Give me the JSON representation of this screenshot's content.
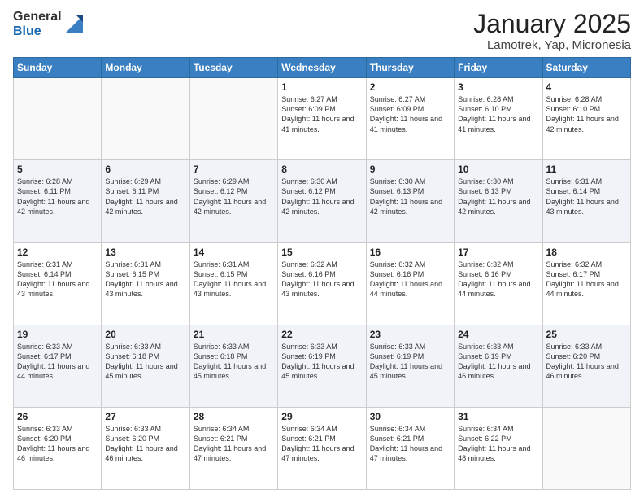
{
  "logo": {
    "line1": "General",
    "line2": "Blue"
  },
  "header": {
    "title": "January 2025",
    "subtitle": "Lamotrek, Yap, Micronesia"
  },
  "days_of_week": [
    "Sunday",
    "Monday",
    "Tuesday",
    "Wednesday",
    "Thursday",
    "Friday",
    "Saturday"
  ],
  "weeks": [
    [
      {
        "day": "",
        "info": ""
      },
      {
        "day": "",
        "info": ""
      },
      {
        "day": "",
        "info": ""
      },
      {
        "day": "1",
        "info": "Sunrise: 6:27 AM\nSunset: 6:09 PM\nDaylight: 11 hours and 41 minutes."
      },
      {
        "day": "2",
        "info": "Sunrise: 6:27 AM\nSunset: 6:09 PM\nDaylight: 11 hours and 41 minutes."
      },
      {
        "day": "3",
        "info": "Sunrise: 6:28 AM\nSunset: 6:10 PM\nDaylight: 11 hours and 41 minutes."
      },
      {
        "day": "4",
        "info": "Sunrise: 6:28 AM\nSunset: 6:10 PM\nDaylight: 11 hours and 42 minutes."
      }
    ],
    [
      {
        "day": "5",
        "info": "Sunrise: 6:28 AM\nSunset: 6:11 PM\nDaylight: 11 hours and 42 minutes."
      },
      {
        "day": "6",
        "info": "Sunrise: 6:29 AM\nSunset: 6:11 PM\nDaylight: 11 hours and 42 minutes."
      },
      {
        "day": "7",
        "info": "Sunrise: 6:29 AM\nSunset: 6:12 PM\nDaylight: 11 hours and 42 minutes."
      },
      {
        "day": "8",
        "info": "Sunrise: 6:30 AM\nSunset: 6:12 PM\nDaylight: 11 hours and 42 minutes."
      },
      {
        "day": "9",
        "info": "Sunrise: 6:30 AM\nSunset: 6:13 PM\nDaylight: 11 hours and 42 minutes."
      },
      {
        "day": "10",
        "info": "Sunrise: 6:30 AM\nSunset: 6:13 PM\nDaylight: 11 hours and 42 minutes."
      },
      {
        "day": "11",
        "info": "Sunrise: 6:31 AM\nSunset: 6:14 PM\nDaylight: 11 hours and 43 minutes."
      }
    ],
    [
      {
        "day": "12",
        "info": "Sunrise: 6:31 AM\nSunset: 6:14 PM\nDaylight: 11 hours and 43 minutes."
      },
      {
        "day": "13",
        "info": "Sunrise: 6:31 AM\nSunset: 6:15 PM\nDaylight: 11 hours and 43 minutes."
      },
      {
        "day": "14",
        "info": "Sunrise: 6:31 AM\nSunset: 6:15 PM\nDaylight: 11 hours and 43 minutes."
      },
      {
        "day": "15",
        "info": "Sunrise: 6:32 AM\nSunset: 6:16 PM\nDaylight: 11 hours and 43 minutes."
      },
      {
        "day": "16",
        "info": "Sunrise: 6:32 AM\nSunset: 6:16 PM\nDaylight: 11 hours and 44 minutes."
      },
      {
        "day": "17",
        "info": "Sunrise: 6:32 AM\nSunset: 6:16 PM\nDaylight: 11 hours and 44 minutes."
      },
      {
        "day": "18",
        "info": "Sunrise: 6:32 AM\nSunset: 6:17 PM\nDaylight: 11 hours and 44 minutes."
      }
    ],
    [
      {
        "day": "19",
        "info": "Sunrise: 6:33 AM\nSunset: 6:17 PM\nDaylight: 11 hours and 44 minutes."
      },
      {
        "day": "20",
        "info": "Sunrise: 6:33 AM\nSunset: 6:18 PM\nDaylight: 11 hours and 45 minutes."
      },
      {
        "day": "21",
        "info": "Sunrise: 6:33 AM\nSunset: 6:18 PM\nDaylight: 11 hours and 45 minutes."
      },
      {
        "day": "22",
        "info": "Sunrise: 6:33 AM\nSunset: 6:19 PM\nDaylight: 11 hours and 45 minutes."
      },
      {
        "day": "23",
        "info": "Sunrise: 6:33 AM\nSunset: 6:19 PM\nDaylight: 11 hours and 45 minutes."
      },
      {
        "day": "24",
        "info": "Sunrise: 6:33 AM\nSunset: 6:19 PM\nDaylight: 11 hours and 46 minutes."
      },
      {
        "day": "25",
        "info": "Sunrise: 6:33 AM\nSunset: 6:20 PM\nDaylight: 11 hours and 46 minutes."
      }
    ],
    [
      {
        "day": "26",
        "info": "Sunrise: 6:33 AM\nSunset: 6:20 PM\nDaylight: 11 hours and 46 minutes."
      },
      {
        "day": "27",
        "info": "Sunrise: 6:33 AM\nSunset: 6:20 PM\nDaylight: 11 hours and 46 minutes."
      },
      {
        "day": "28",
        "info": "Sunrise: 6:34 AM\nSunset: 6:21 PM\nDaylight: 11 hours and 47 minutes."
      },
      {
        "day": "29",
        "info": "Sunrise: 6:34 AM\nSunset: 6:21 PM\nDaylight: 11 hours and 47 minutes."
      },
      {
        "day": "30",
        "info": "Sunrise: 6:34 AM\nSunset: 6:21 PM\nDaylight: 11 hours and 47 minutes."
      },
      {
        "day": "31",
        "info": "Sunrise: 6:34 AM\nSunset: 6:22 PM\nDaylight: 11 hours and 48 minutes."
      },
      {
        "day": "",
        "info": ""
      }
    ]
  ]
}
